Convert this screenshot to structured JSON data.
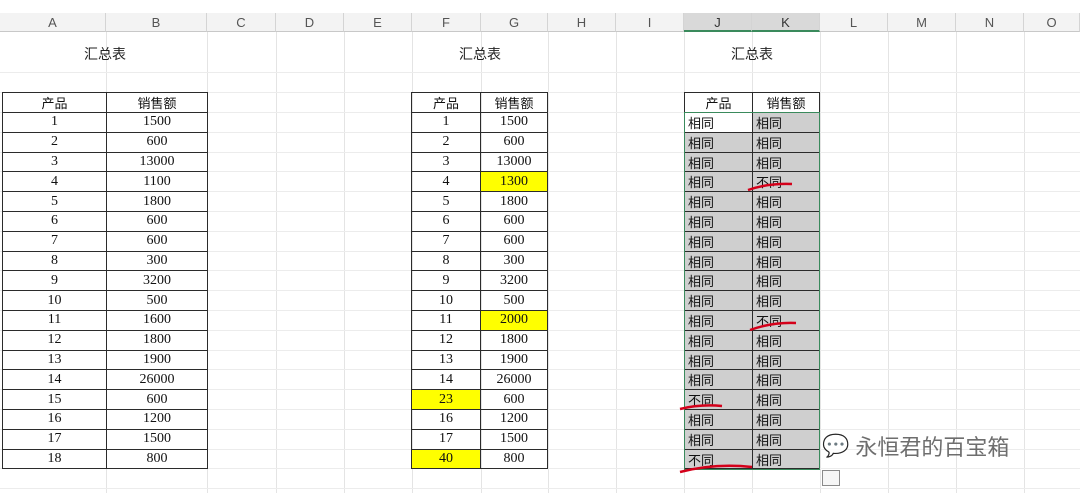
{
  "columns": [
    "A",
    "B",
    "C",
    "D",
    "E",
    "F",
    "G",
    "H",
    "I",
    "J",
    "K",
    "L",
    "M",
    "N",
    "O"
  ],
  "selected_columns": [
    "J",
    "K"
  ],
  "title": "汇总表",
  "headers": {
    "product": "产品",
    "sales": "销售额"
  },
  "table1": {
    "products": [
      "1",
      "2",
      "3",
      "4",
      "5",
      "6",
      "7",
      "8",
      "9",
      "10",
      "11",
      "12",
      "13",
      "14",
      "15",
      "16",
      "17",
      "18"
    ],
    "sales": [
      "1500",
      "600",
      "13000",
      "1100",
      "1800",
      "600",
      "600",
      "300",
      "3200",
      "500",
      "1600",
      "1800",
      "1900",
      "26000",
      "600",
      "1200",
      "1500",
      "800"
    ]
  },
  "table2": {
    "products": [
      "1",
      "2",
      "3",
      "4",
      "5",
      "6",
      "7",
      "8",
      "9",
      "10",
      "11",
      "12",
      "13",
      "14",
      "23",
      "16",
      "17",
      "40"
    ],
    "sales": [
      "1500",
      "600",
      "13000",
      "1300",
      "1800",
      "600",
      "600",
      "300",
      "3200",
      "500",
      "2000",
      "1800",
      "1900",
      "26000",
      "600",
      "1200",
      "1500",
      "800"
    ],
    "highlighted_product_rows": [
      14,
      17
    ],
    "highlighted_sales_rows": [
      3,
      10
    ]
  },
  "table3": {
    "products": [
      "相同",
      "相同",
      "相同",
      "相同",
      "相同",
      "相同",
      "相同",
      "相同",
      "相同",
      "相同",
      "相同",
      "相同",
      "相同",
      "相同",
      "不同",
      "相同",
      "相同",
      "不同"
    ],
    "sales": [
      "相同",
      "相同",
      "相同",
      "不同",
      "相同",
      "相同",
      "相同",
      "相同",
      "相同",
      "相同",
      "不同",
      "相同",
      "相同",
      "相同",
      "相同",
      "相同",
      "相同",
      "相同"
    ]
  },
  "watermark": "永恒君的百宝箱",
  "colors": {
    "highlight": "#ffff00",
    "selection": "#cfcfcf",
    "annotation": "#d4001a",
    "selection_border": "#3a8a5c"
  }
}
